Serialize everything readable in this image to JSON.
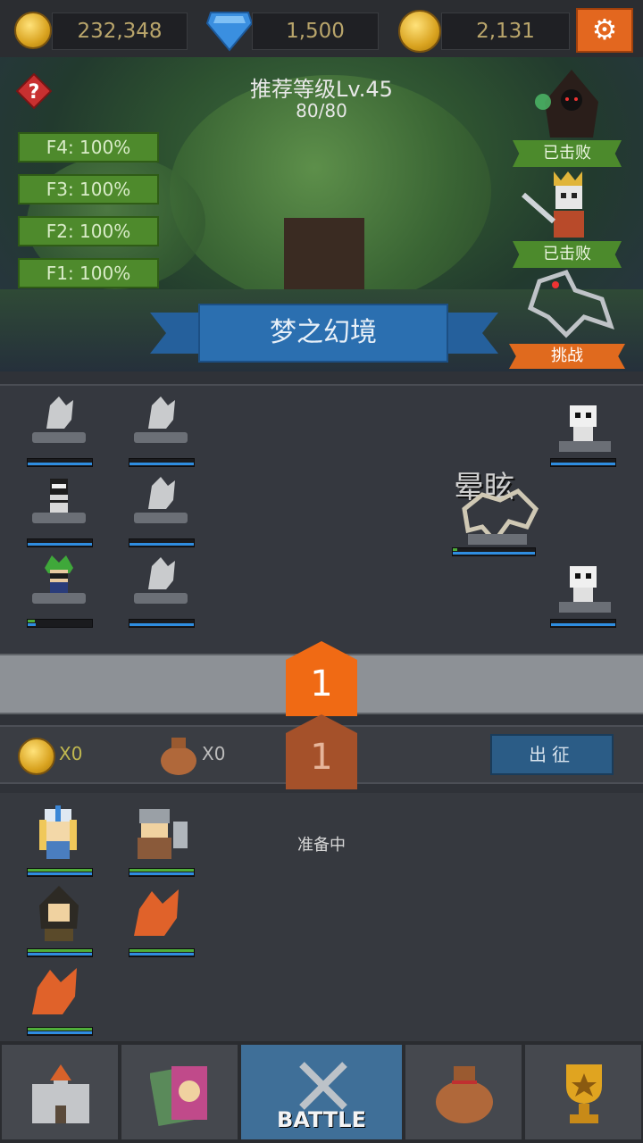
{
  "currencies": {
    "gold": "232,348",
    "gems": "1,500",
    "medals": "2,131"
  },
  "stage": {
    "recommended_level": "推荐等级Lv.45",
    "stamina": "80/80",
    "name": "梦之幻境",
    "floors": [
      "F4: 100%",
      "F3: 100%",
      "F2: 100%",
      "F1: 100%"
    ],
    "bosses": [
      {
        "status": "已击败"
      },
      {
        "status": "已击败"
      },
      {
        "status": "挑战"
      }
    ]
  },
  "battle": {
    "dizzy_label": "晕眩",
    "wave_number": "1",
    "next_wave_number": "1"
  },
  "rewards": {
    "coins": "X0",
    "bags": "X0",
    "deploy_label": "出征"
  },
  "team": {
    "status": "准备中"
  },
  "nav": {
    "battle_label": "BATTLE"
  },
  "colors": {
    "accent_orange": "#e3671f",
    "hp_green": "#4fae3a",
    "mp_blue": "#2f8de0",
    "active_tab": "#3f6f98"
  }
}
